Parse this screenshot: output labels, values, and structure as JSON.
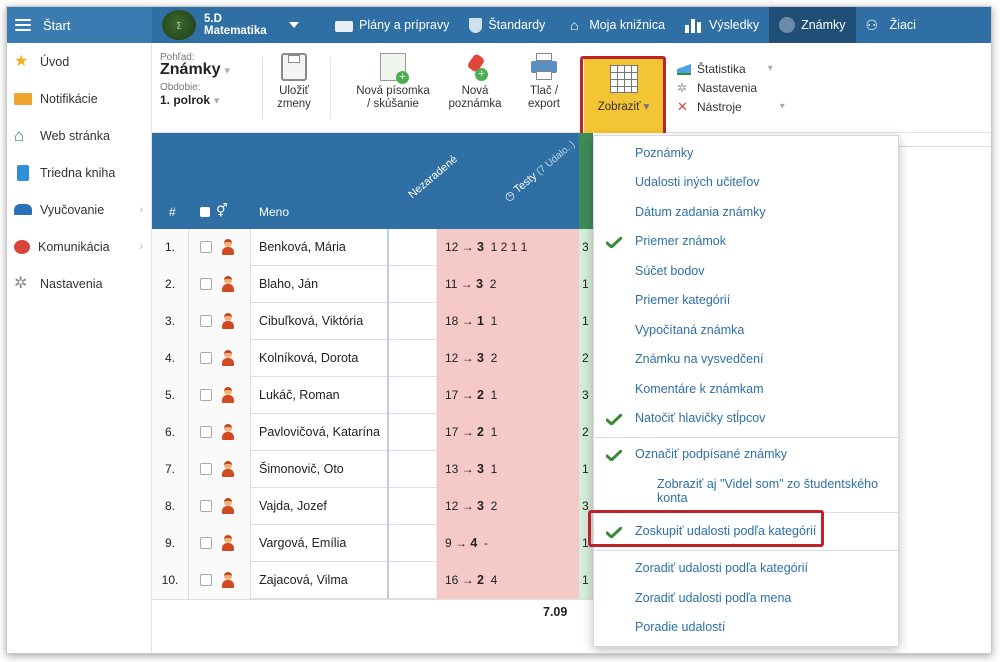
{
  "topbar": {
    "start_label": "Štart",
    "class_line1": "5.D",
    "class_line2": "Matematika",
    "nav": [
      "Plány a prípravy",
      "Štandardy",
      "Moja knižnica",
      "Výsledky",
      "Známky",
      "Žiaci"
    ],
    "active": "Známky"
  },
  "sidebar": {
    "items": [
      "Úvod",
      "Notifikácie",
      "Web stránka",
      "Triedna kniha",
      "Vyučovanie",
      "Komunikácia",
      "Nastavenia"
    ]
  },
  "toolbar": {
    "view_caption": "Pohľad:",
    "view_value": "Známky",
    "period_caption": "Obdobie:",
    "period_value": "1. polrok",
    "save": [
      "Uložiť",
      "zmeny"
    ],
    "new_test": [
      "Nová písomka",
      "/ skúšanie"
    ],
    "new_note": [
      "Nová",
      "poznámka"
    ],
    "print": [
      "Tlač /",
      "export"
    ],
    "show": "Zobraziť",
    "right_menu": [
      "Štatistika",
      "Nastavenia",
      "Nástroje"
    ]
  },
  "table": {
    "headers": {
      "num": "#",
      "name": "Meno",
      "unassigned": "Nezaradené",
      "tests": "Testy",
      "tests_sub": "(7 Udalo..)"
    },
    "rows": [
      {
        "num": "1.",
        "name": "Benková, Mária",
        "points": "12",
        "grade": "3",
        "rest": "1 2 1 1",
        "green": "3"
      },
      {
        "num": "2.",
        "name": "Blaho, Ján",
        "points": "11",
        "grade": "3",
        "rest": "2",
        "green": "1"
      },
      {
        "num": "3.",
        "name": "Cibuľková, Viktória",
        "points": "18",
        "grade": "1",
        "rest": "1",
        "green": "1"
      },
      {
        "num": "4.",
        "name": "Kolníková, Dorota",
        "points": "12",
        "grade": "3",
        "rest": "2",
        "green": "2"
      },
      {
        "num": "5.",
        "name": "Lukáč, Roman",
        "points": "17",
        "grade": "2",
        "rest": "1",
        "green": "3"
      },
      {
        "num": "6.",
        "name": "Pavlovičová, Katarína",
        "points": "17",
        "grade": "2",
        "rest": "1",
        "green": "2"
      },
      {
        "num": "7.",
        "name": "Šimonovič, Oto",
        "points": "13",
        "grade": "3",
        "rest": "1",
        "green": "1"
      },
      {
        "num": "8.",
        "name": "Vajda, Jozef",
        "points": "12",
        "grade": "3",
        "rest": "2",
        "green": "3"
      },
      {
        "num": "9.",
        "name": "Vargová, Emília",
        "points": "9",
        "grade": "4",
        "rest": "-",
        "green": "1"
      },
      {
        "num": "10.",
        "name": "Zajacová, Vilma",
        "points": "16",
        "grade": "2",
        "rest": "4",
        "green": "1"
      }
    ],
    "average": "7.09"
  },
  "dropdown": {
    "items": [
      {
        "label": "Poznámky",
        "checked": false
      },
      {
        "label": "Udalosti iných učiteľov",
        "checked": false
      },
      {
        "label": "Dátum zadania známky",
        "checked": false
      },
      {
        "label": "Priemer známok",
        "checked": true
      },
      {
        "label": "Súčet bodov",
        "checked": false
      },
      {
        "label": "Priemer kategórií",
        "checked": false
      },
      {
        "label": "Vypočítaná známka",
        "checked": false
      },
      {
        "label": "Známku na vysvedčení",
        "checked": false
      },
      {
        "label": "Komentáre k známkam",
        "checked": false
      },
      {
        "label": "Natočiť hlavičky stĺpcov",
        "checked": true
      },
      {
        "label": "Označiť podpísané známky",
        "checked": true
      },
      {
        "label": "Zobraziť aj \"Videl som\" zo študentského konta",
        "checked": false
      },
      {
        "label": "Zoskupiť udalosti podľa kategórií",
        "checked": true
      },
      {
        "label": "Zoradiť udalosti podľa kategórií",
        "checked": false
      },
      {
        "label": "Zoradiť udalosti podľa mena",
        "checked": false
      },
      {
        "label": "Poradie udalostí",
        "checked": false
      }
    ]
  },
  "colors": {
    "brand": "#2f6fa3",
    "highlight": "#f3c433",
    "annotation": "#c0222a",
    "check": "#3a8a35"
  }
}
